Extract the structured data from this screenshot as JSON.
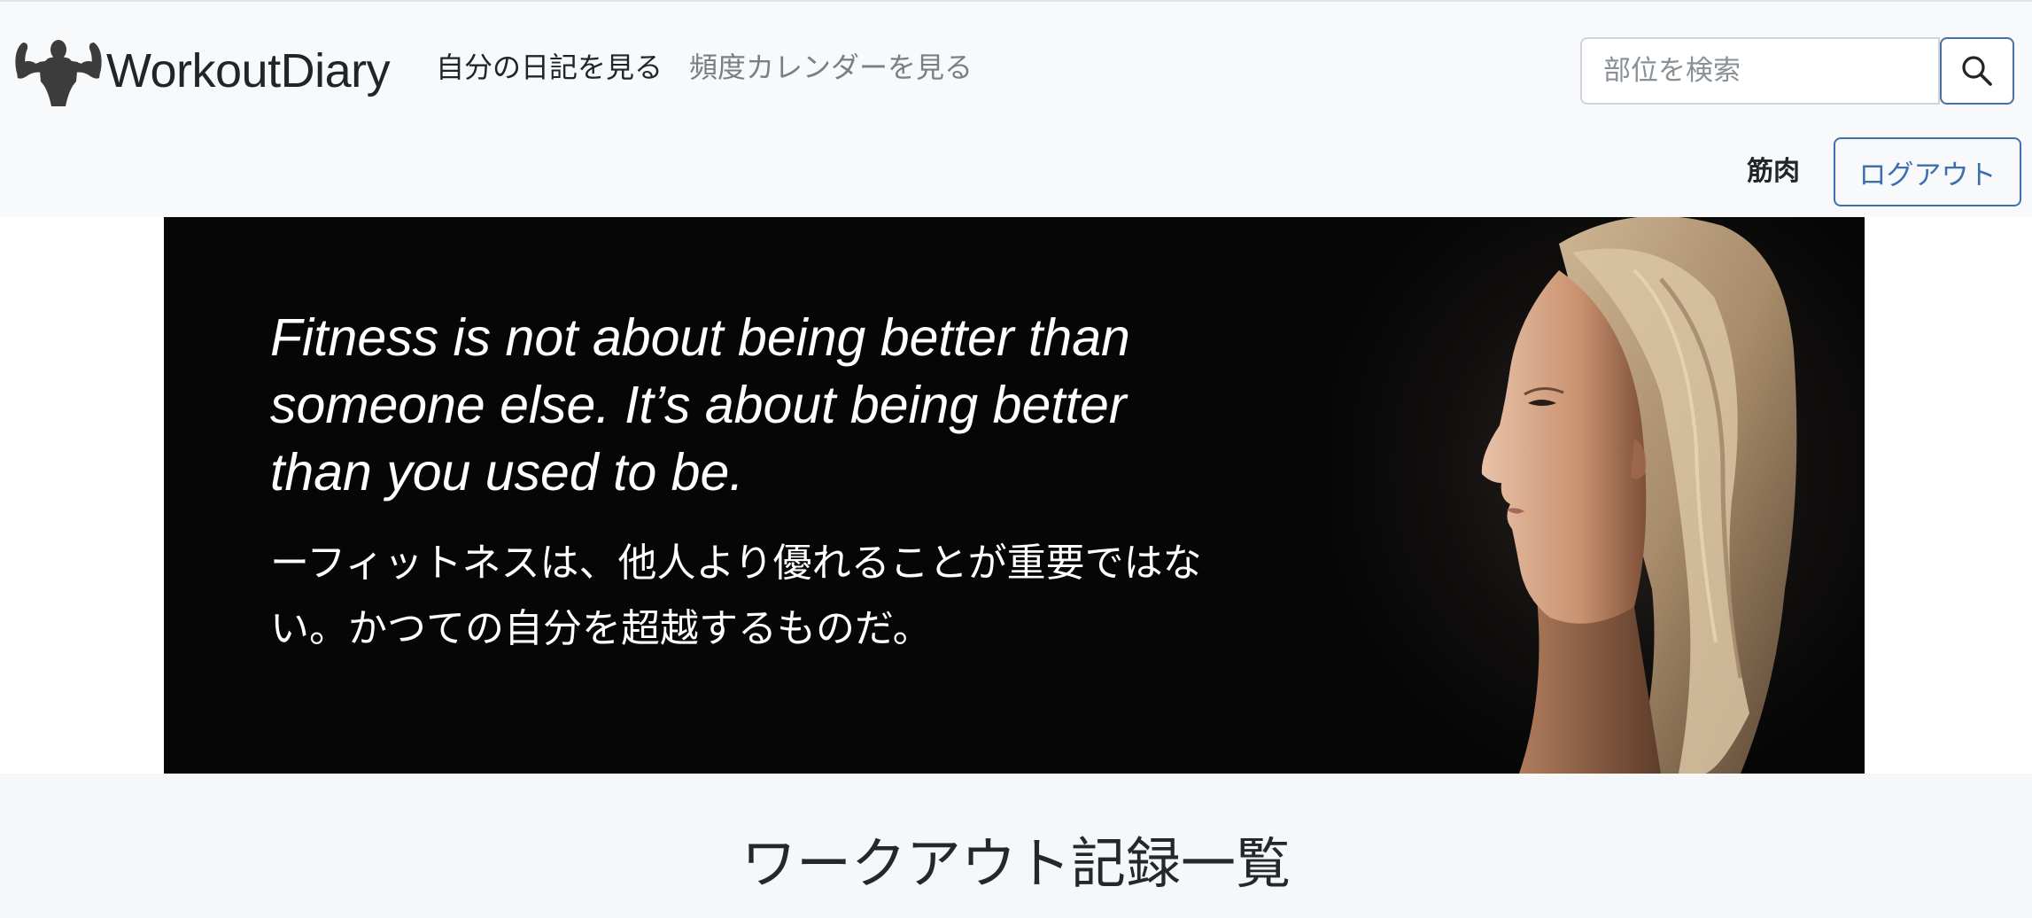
{
  "brand": {
    "name": "WorkoutDiary",
    "logo_icon": "flexing-bodybuilder-icon"
  },
  "nav": {
    "diary_link": "自分の日記を見る",
    "calendar_link": "頻度カレンダーを見る"
  },
  "search": {
    "placeholder": "部位を検索",
    "value": "",
    "button_icon": "search-icon"
  },
  "user": {
    "name": "筋肉",
    "logout_label": "ログアウト"
  },
  "hero": {
    "quote_en": "Fitness is not about being better than someone else. It’s about being better than you used to be.",
    "quote_ja": "ーフィットネスは、他人より優れることが重要ではない。かつての自分を超越するものだ。"
  },
  "section": {
    "title": "ワークアウト記録一覧"
  },
  "colors": {
    "navbar_bg": "#f8f9fb",
    "primary_outline": "#3d6fb0",
    "hero_bg": "#060606"
  }
}
